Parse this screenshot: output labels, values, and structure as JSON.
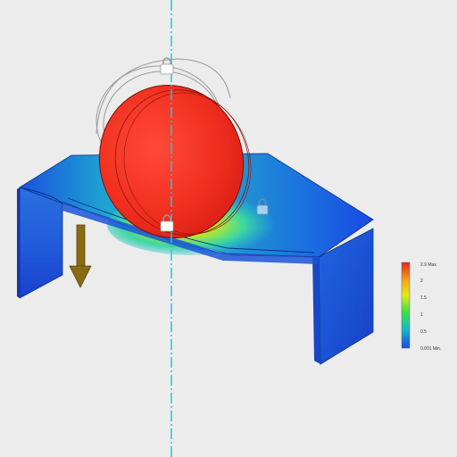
{
  "viewport": {
    "background": "#ececec",
    "symmetry_axis_color": "#22c7d6",
    "load_arrow_color": "#8a6b12"
  },
  "legend": {
    "max_label": "2.9 Max.",
    "tick_2": "2",
    "tick_1_5": "1.5",
    "tick_1": "1",
    "tick_0_5": "0.5",
    "min_label": "0.001 Min.",
    "gradient_colors": [
      "#e8231b",
      "#f0a21a",
      "#e8e81a",
      "#3ce04a",
      "#18b9c8",
      "#1a49e0"
    ]
  },
  "icons": [
    "lock-icon",
    "lock-icon",
    "lock-icon",
    "down-arrow-icon"
  ]
}
